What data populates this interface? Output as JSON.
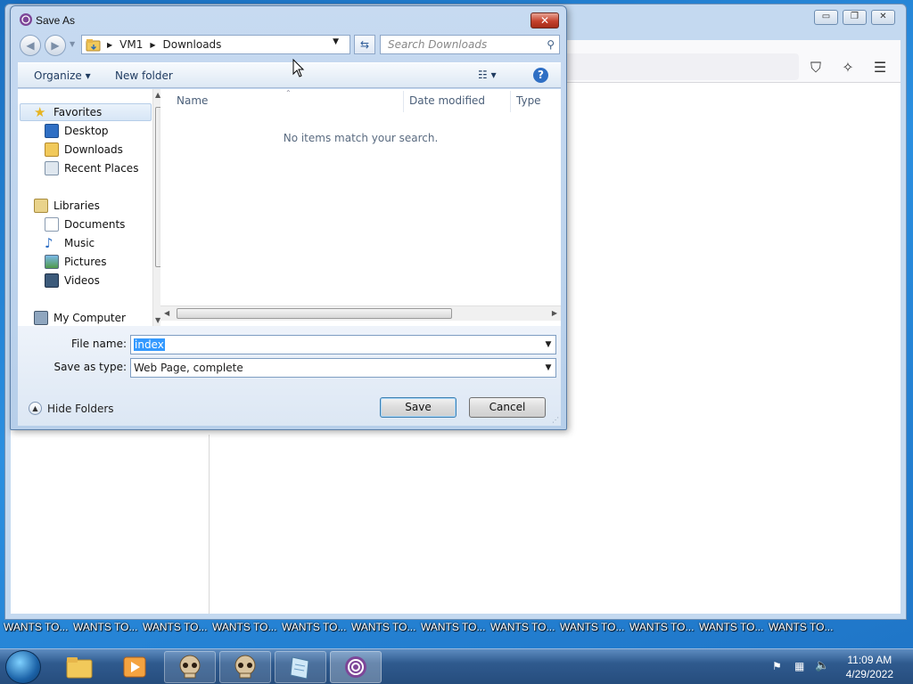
{
  "browser": {
    "minimize_icon": "minimize-icon",
    "restore_icon": "restore-icon",
    "close_icon": "close-icon"
  },
  "dialog": {
    "title": "Save As",
    "breadcrumb": [
      "VM1",
      "Downloads"
    ],
    "search_placeholder": "Search Downloads",
    "toolbar": {
      "organize": "Organize ▾",
      "new_folder": "New folder"
    },
    "nav": {
      "favorites_header": "Favorites",
      "favorites": [
        "Desktop",
        "Downloads",
        "Recent Places"
      ],
      "libraries_header": "Libraries",
      "libraries": [
        "Documents",
        "Music",
        "Pictures",
        "Videos"
      ],
      "computer": "My Computer"
    },
    "columns": [
      "Name",
      "Date modified",
      "Type"
    ],
    "empty_message": "No items match your search.",
    "file_name_label": "File name:",
    "file_name_value": "index",
    "save_type_label": "Save as type:",
    "save_type_value": "Web Page, complete",
    "hide_folders": "Hide Folders",
    "save_button": "Save",
    "cancel_button": "Cancel"
  },
  "wants_strip": [
    "WANTS TO...",
    "WANTS TO...",
    "WANTS TO...",
    "WANTS TO...",
    "WANTS TO...",
    "WANTS TO...",
    "WANTS TO...",
    "WANTS TO...",
    "WANTS TO...",
    "WANTS TO...",
    "WANTS TO...",
    "WANTS TO..."
  ],
  "taskbar": {
    "time": "11:09 AM",
    "date": "4/29/2022"
  }
}
